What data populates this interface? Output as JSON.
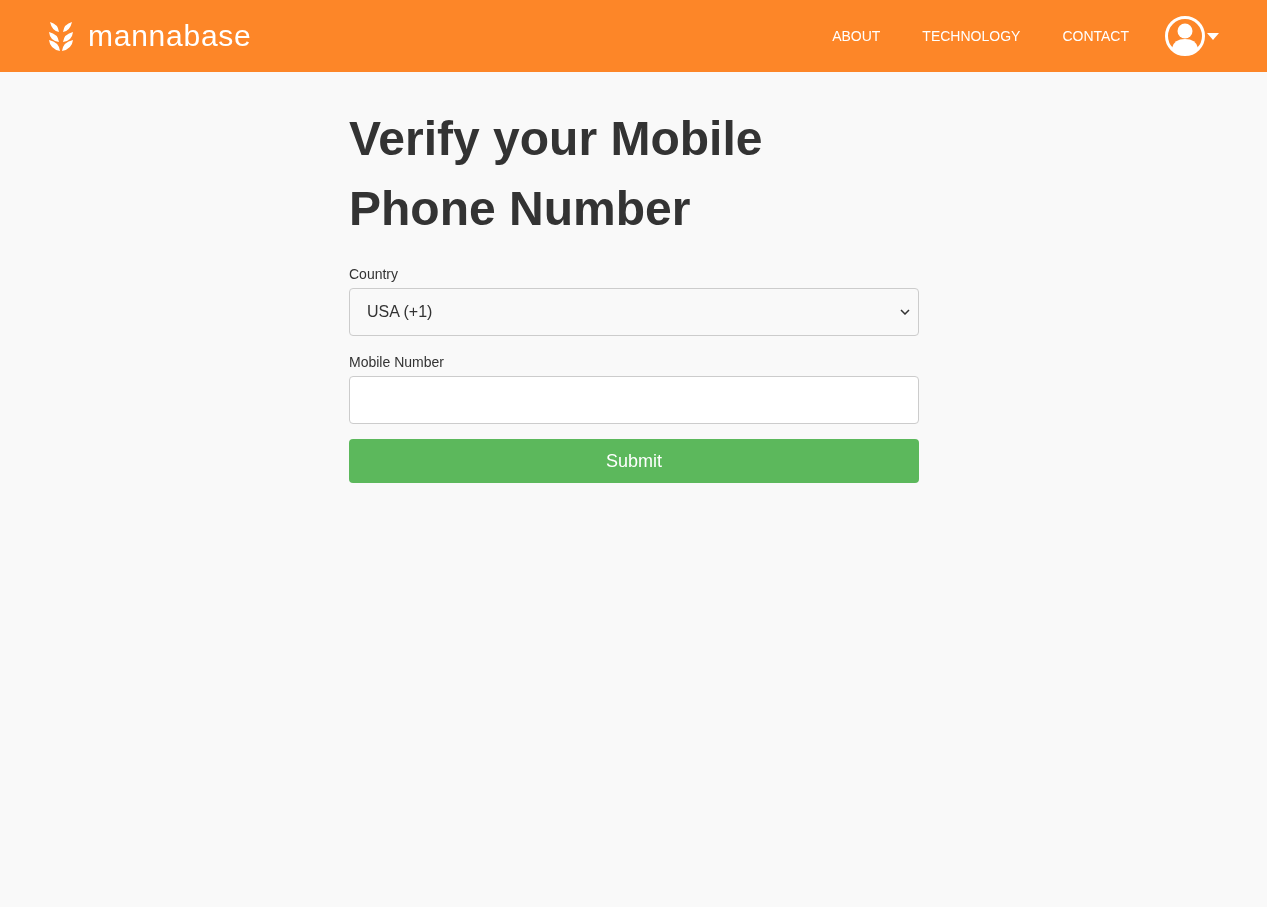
{
  "header": {
    "logo_text": "mannabase",
    "nav": [
      {
        "label": "ABOUT"
      },
      {
        "label": "TECHNOLOGY"
      },
      {
        "label": "CONTACT"
      }
    ]
  },
  "title": "Verify your Mobile Phone Number",
  "form": {
    "country": {
      "label": "Country",
      "value": "USA (+1)"
    },
    "mobile": {
      "label": "Mobile Number"
    },
    "submit": "Submit"
  }
}
